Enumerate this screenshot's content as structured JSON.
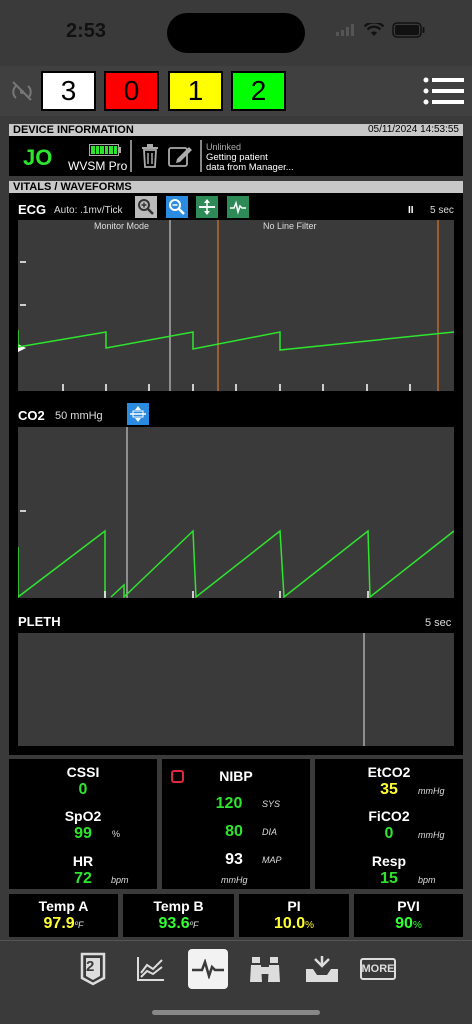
{
  "status_bar": {
    "time": "2:53"
  },
  "triage": [
    {
      "label": "3",
      "color": "#ffffff"
    },
    {
      "label": "0",
      "color": "#ff0000"
    },
    {
      "label": "1",
      "color": "#ffff00"
    },
    {
      "label": "2",
      "color": "#00ff00"
    }
  ],
  "device_info": {
    "header": "DEVICE INFORMATION",
    "datetime": "05/11/2024 14:53:55",
    "initials": "JO",
    "device_name": "WVSM Pro",
    "link_status": "Unlinked",
    "link_message_1": "Getting patient",
    "link_message_2": "data from Manager..."
  },
  "vitals": {
    "header": "VITALS / WAVEFORMS",
    "ecg": {
      "label": "ECG",
      "scale": "Auto: .1mv/Tick",
      "lead": "II",
      "duration": "5 sec",
      "mode": "Monitor Mode",
      "filter": "No Line Filter"
    },
    "co2": {
      "label": "CO2",
      "scale": "50 mmHg"
    },
    "pleth": {
      "label": "PLETH",
      "duration": "5 sec"
    }
  },
  "stats": {
    "cssi": {
      "name": "CSSI",
      "value": "0"
    },
    "spo2": {
      "name": "SpO2",
      "value": "99",
      "unit": "%"
    },
    "hr": {
      "name": "HR",
      "value": "72",
      "unit": "bpm"
    },
    "nibp": {
      "name": "NIBP",
      "sys": "120",
      "sys_label": "SYS",
      "dia": "80",
      "dia_label": "DIA",
      "map": "93",
      "map_label": "MAP",
      "unit": "mmHg"
    },
    "etco2": {
      "name": "EtCO2",
      "value": "35",
      "unit": "mmHg"
    },
    "fico2": {
      "name": "FiCO2",
      "value": "0",
      "unit": "mmHg"
    },
    "resp": {
      "name": "Resp",
      "value": "15",
      "unit": "bpm"
    }
  },
  "bottom_stats": [
    {
      "name": "Temp A",
      "value": "97.9",
      "unit": "ºF",
      "color": "#ffff33"
    },
    {
      "name": "Temp B",
      "value": "93.6",
      "unit": "ºF",
      "color": "#33ff33"
    },
    {
      "name": "PI",
      "value": "10.0",
      "unit": "%",
      "color": "#ffff33"
    },
    {
      "name": "PVI",
      "value": "90",
      "unit": "%",
      "color": "#33ff33"
    }
  ],
  "tabs": [
    {
      "icon": "patient-count-icon",
      "label": "2"
    },
    {
      "icon": "trend-chart-icon"
    },
    {
      "icon": "waveform-icon"
    },
    {
      "icon": "binoculars-icon"
    },
    {
      "icon": "tray-download-icon"
    },
    {
      "icon": "more-icon",
      "label": "MORE"
    }
  ],
  "colors": {
    "green": "#2ee52e",
    "yellow": "#ffff33",
    "orange": "#d9762a"
  }
}
